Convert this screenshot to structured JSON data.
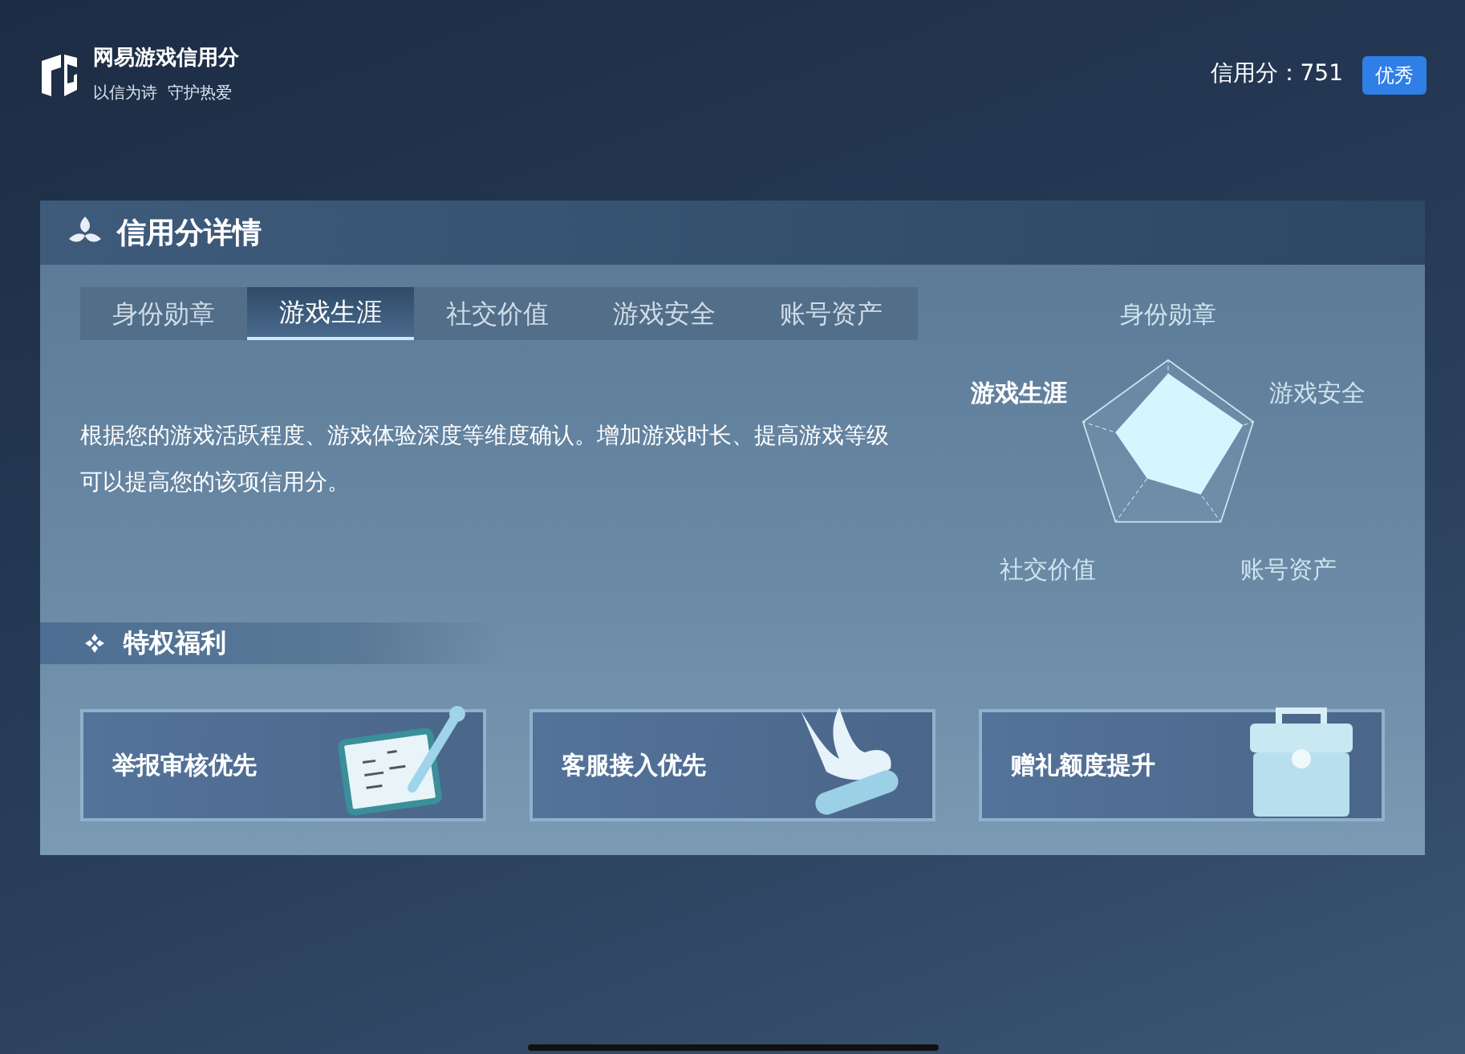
{
  "brand": {
    "name": "网易游戏信用分",
    "slogan": "以信为诗  守护热爱"
  },
  "score": {
    "label": "信用分：",
    "value": "751",
    "badge": "优秀"
  },
  "panel": {
    "title": "信用分详情"
  },
  "tabs": [
    {
      "label": "身份勋章",
      "selected": false
    },
    {
      "label": "游戏生涯",
      "selected": true
    },
    {
      "label": "社交价值",
      "selected": false
    },
    {
      "label": "游戏安全",
      "selected": false
    },
    {
      "label": "账号资产",
      "selected": false
    }
  ],
  "description": "根据您的游戏活跃程度、游戏体验深度等维度确认。增加游戏时长、提高游戏等级可以提高您的该项信用分。",
  "radar_labels": [
    {
      "label": "身份勋章",
      "selected": false
    },
    {
      "label": "游戏安全",
      "selected": false
    },
    {
      "label": "账号资产",
      "selected": false
    },
    {
      "label": "社交价值",
      "selected": false
    },
    {
      "label": "游戏生涯",
      "selected": true
    }
  ],
  "perks": {
    "title": "特权福利",
    "items": [
      {
        "label": "举报审核优先",
        "kind": "scroll"
      },
      {
        "label": "客服接入优先",
        "kind": "bird"
      },
      {
        "label": "赠礼额度提升",
        "kind": "chest"
      }
    ]
  }
}
